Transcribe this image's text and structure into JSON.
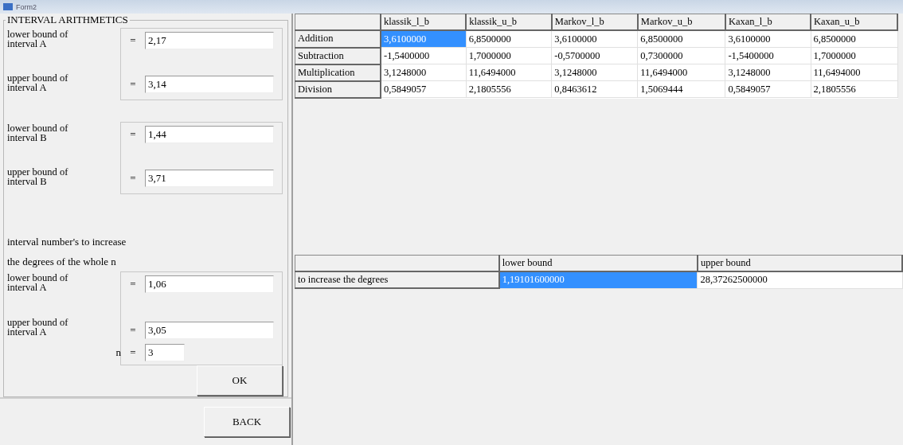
{
  "window": {
    "title": "Form2"
  },
  "group": {
    "title": "INTERVAL ARITHMETICS"
  },
  "interval_boxes": [
    {
      "fields": [
        {
          "label": "lower bound of interval A",
          "sign": "=",
          "value": "2,17"
        },
        {
          "label": "upper bound of interval A",
          "sign": "=",
          "value": "3,14"
        }
      ]
    },
    {
      "fields": [
        {
          "label": "lower bound of interval B",
          "sign": "=",
          "value": "1,44"
        },
        {
          "label": "upper bound of interval B",
          "sign": "=",
          "value": "3,71"
        }
      ]
    }
  ],
  "power_note": [
    "interval number's to increase",
    "the degrees of the whole n"
  ],
  "power_fields": [
    {
      "kind": "bound",
      "label": "lower bound of interval A",
      "sign": "=",
      "value": "1,06"
    },
    {
      "kind": "bound",
      "label": "upper bound of interval A",
      "sign": "=",
      "value": "3,05"
    },
    {
      "kind": "short",
      "label": "n",
      "sign": "=",
      "value": "3"
    }
  ],
  "buttons": {
    "ok": "OK",
    "back": "BACK"
  },
  "results_table": {
    "columns": [
      "klassik_l_b",
      "klassik_u_b",
      "Markov_l_b",
      "Markov_u_b",
      "Kaxan_l_b",
      "Kaxan_u_b"
    ],
    "rows": [
      {
        "label": "Addition",
        "cells": [
          {
            "value": "3,6100000",
            "selected": true
          },
          {
            "value": "6,8500000",
            "selected": false
          },
          {
            "value": "3,6100000",
            "selected": false
          },
          {
            "value": "6,8500000",
            "selected": false
          },
          {
            "value": "3,6100000",
            "selected": false
          },
          {
            "value": "6,8500000",
            "selected": false
          }
        ]
      },
      {
        "label": "Subtraction",
        "cells": [
          {
            "value": "-1,5400000",
            "selected": false
          },
          {
            "value": "1,7000000",
            "selected": false
          },
          {
            "value": "-0,5700000",
            "selected": false
          },
          {
            "value": "0,7300000",
            "selected": false
          },
          {
            "value": "-1,5400000",
            "selected": false
          },
          {
            "value": "1,7000000",
            "selected": false
          }
        ]
      },
      {
        "label": "Multiplication",
        "cells": [
          {
            "value": "3,1248000",
            "selected": false
          },
          {
            "value": "11,6494000",
            "selected": false
          },
          {
            "value": "3,1248000",
            "selected": false
          },
          {
            "value": "11,6494000",
            "selected": false
          },
          {
            "value": "3,1248000",
            "selected": false
          },
          {
            "value": "11,6494000",
            "selected": false
          }
        ]
      },
      {
        "label": "Division",
        "cells": [
          {
            "value": "0,5849057",
            "selected": false
          },
          {
            "value": "2,1805556",
            "selected": false
          },
          {
            "value": "0,8463612",
            "selected": false
          },
          {
            "value": "1,5069444",
            "selected": false
          },
          {
            "value": "0,5849057",
            "selected": false
          },
          {
            "value": "2,1805556",
            "selected": false
          }
        ]
      }
    ]
  },
  "power_table": {
    "columns": [
      "lower bound",
      "upper bound"
    ],
    "rows": [
      {
        "label": "to increase the degrees",
        "cells": [
          {
            "value": "1,19101600000",
            "selected": true
          },
          {
            "value": "28,37262500000",
            "selected": false
          }
        ]
      }
    ]
  }
}
